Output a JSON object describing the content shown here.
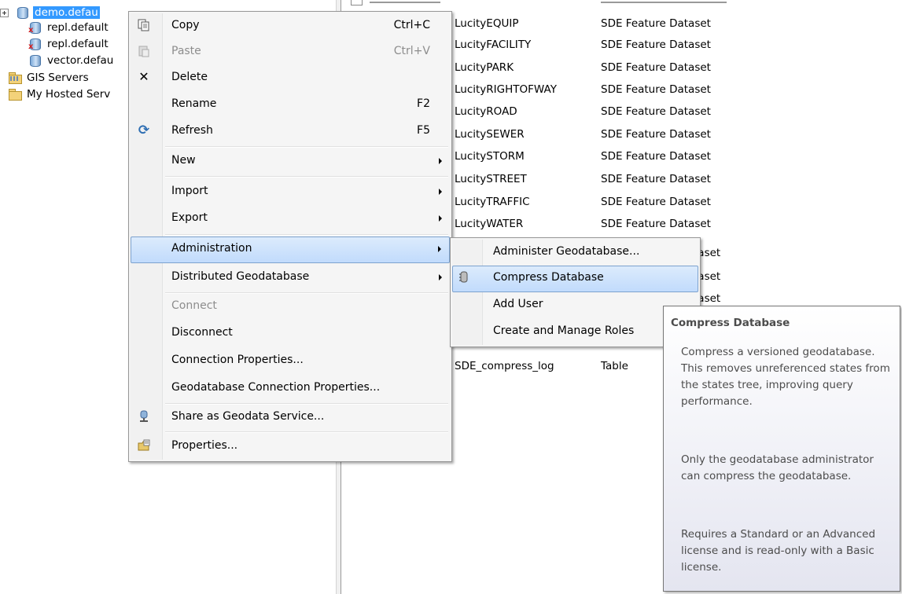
{
  "tree": {
    "items": [
      {
        "label": "demo.defau",
        "icon": "database-icon"
      },
      {
        "label": "repl.default",
        "icon": "database-error-icon"
      },
      {
        "label": "repl.default",
        "icon": "database-error-icon"
      },
      {
        "label": "vector.defau",
        "icon": "database-icon"
      },
      {
        "label": "GIS Servers",
        "icon": "gis-servers-icon"
      },
      {
        "label": "My Hosted Serv",
        "icon": "hosted-services-icon"
      }
    ]
  },
  "list": {
    "rows": [
      {
        "name": "LucityEQUIP",
        "type": "SDE Feature Dataset"
      },
      {
        "name": "LucityFACILITY",
        "type": "SDE Feature Dataset"
      },
      {
        "name": "LucityPARK",
        "type": "SDE Feature Dataset"
      },
      {
        "name": "LucityRIGHTOFWAY",
        "type": "SDE Feature Dataset"
      },
      {
        "name": "LucityROAD",
        "type": "SDE Feature Dataset"
      },
      {
        "name": "LucitySEWER",
        "type": "SDE Feature Dataset"
      },
      {
        "name": "LucitySTORM",
        "type": "SDE Feature Dataset"
      },
      {
        "name": "LucitySTREET",
        "type": "SDE Feature Dataset"
      },
      {
        "name": "LucityTRAFFIC",
        "type": "SDE Feature Dataset"
      },
      {
        "name": "LucityWATER",
        "type": "SDE Feature Dataset"
      },
      {
        "name": "",
        "type": "taset"
      },
      {
        "name": "",
        "type": "taset"
      },
      {
        "name": "",
        "type": "taset"
      },
      {
        "name": "SDE_compress_log",
        "type": "Table"
      }
    ]
  },
  "context_menu": {
    "items": [
      {
        "label": "Copy",
        "shortcut": "Ctrl+C"
      },
      {
        "label": "Paste",
        "shortcut": "Ctrl+V"
      },
      {
        "label": "Delete"
      },
      {
        "label": "Rename",
        "shortcut": "F2"
      },
      {
        "label": "Refresh",
        "shortcut": "F5"
      },
      {
        "label": "New"
      },
      {
        "label": "Import"
      },
      {
        "label": "Export"
      },
      {
        "label": "Administration"
      },
      {
        "label": "Distributed Geodatabase"
      },
      {
        "label": "Connect"
      },
      {
        "label": "Disconnect"
      },
      {
        "label": "Connection Properties..."
      },
      {
        "label": "Geodatabase Connection Properties..."
      },
      {
        "label": "Share as Geodata Service..."
      },
      {
        "label": "Properties..."
      }
    ]
  },
  "submenu": {
    "items": [
      {
        "label": "Administer Geodatabase..."
      },
      {
        "label": "Compress Database"
      },
      {
        "label": "Add User"
      },
      {
        "label": "Create and Manage Roles"
      }
    ]
  },
  "tooltip": {
    "title": "Compress Database",
    "para1": "Compress a versioned geodatabase. This removes unreferenced states from the states tree, improving query performance.",
    "para2": "Only the geodatabase administrator can compress the geodatabase.",
    "para3": "Requires a Standard or an Advanced license and is read-only with a Basic license."
  }
}
